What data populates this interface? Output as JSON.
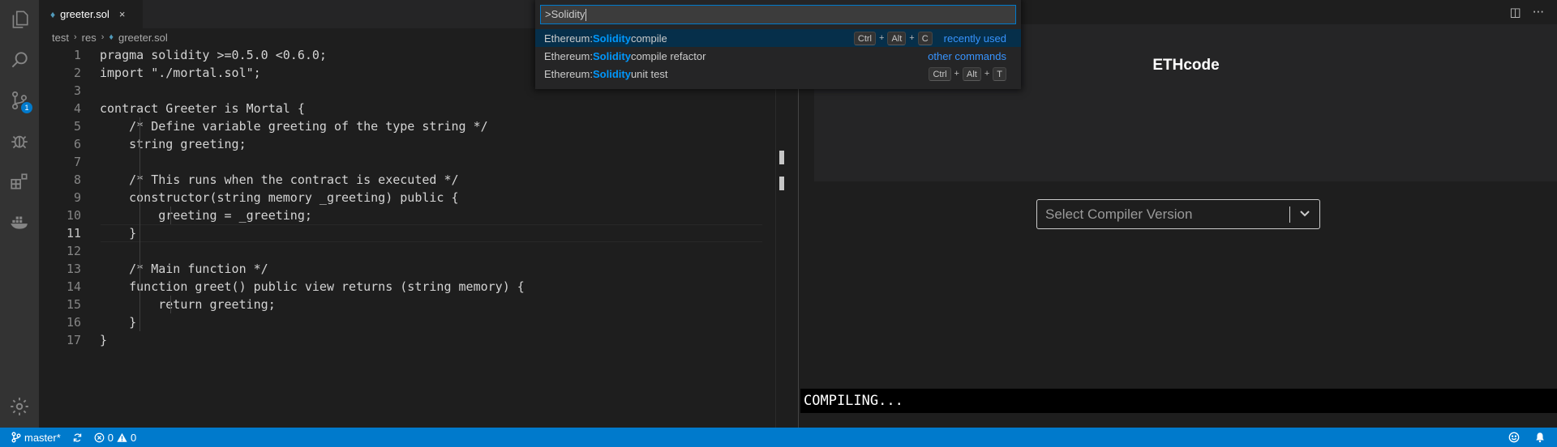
{
  "colors": {
    "accent": "#007acc",
    "highlight": "#0097fb",
    "link": "#3794ff",
    "selection": "#062f4a"
  },
  "activity_bar": {
    "items": [
      {
        "icon": "files-icon"
      },
      {
        "icon": "search-icon"
      },
      {
        "icon": "source-control-icon",
        "badge": "1"
      },
      {
        "icon": "debug-icon"
      },
      {
        "icon": "extensions-icon"
      },
      {
        "icon": "docker-icon"
      }
    ],
    "settings_icon": "gear-icon"
  },
  "editor": {
    "tab": {
      "label": "greeter.sol",
      "close": "×"
    },
    "breadcrumb": [
      "test",
      "res",
      "greeter.sol"
    ],
    "active_line": 11,
    "lines": [
      {
        "n": "1",
        "text": "pragma solidity >=0.5.0 <0.6.0;"
      },
      {
        "n": "2",
        "text": "import \"./mortal.sol\";"
      },
      {
        "n": "3",
        "text": ""
      },
      {
        "n": "4",
        "text": "contract Greeter is Mortal {"
      },
      {
        "n": "5",
        "text": "    /* Define variable greeting of the type string */"
      },
      {
        "n": "6",
        "text": "    string greeting;"
      },
      {
        "n": "7",
        "text": ""
      },
      {
        "n": "8",
        "text": "    /* This runs when the contract is executed */"
      },
      {
        "n": "9",
        "text": "    constructor(string memory _greeting) public {"
      },
      {
        "n": "10",
        "text": "        greeting = _greeting;"
      },
      {
        "n": "11",
        "text": "    }"
      },
      {
        "n": "12",
        "text": ""
      },
      {
        "n": "13",
        "text": "    /* Main function */"
      },
      {
        "n": "14",
        "text": "    function greet() public view returns (string memory) {"
      },
      {
        "n": "15",
        "text": "        return greeting;"
      },
      {
        "n": "16",
        "text": "    }"
      },
      {
        "n": "17",
        "text": "}"
      }
    ]
  },
  "command_palette": {
    "input_value": ">Solidity",
    "items": [
      {
        "prefix": "Ethereum: ",
        "match": "Solidity",
        "suffix": " compile",
        "keys": [
          "Ctrl",
          "Alt",
          "C"
        ],
        "tag": "recently used",
        "selected": true
      },
      {
        "prefix": "Ethereum: ",
        "match": "Solidity",
        "suffix": " compile refactor",
        "keys": [],
        "tag": "other commands",
        "selected": false
      },
      {
        "prefix": "Ethereum: ",
        "match": "Solidity",
        "suffix": " unit test",
        "keys": [
          "Ctrl",
          "Alt",
          "T"
        ],
        "tag": "",
        "selected": false
      }
    ]
  },
  "webview": {
    "title": "ETHcode",
    "select_placeholder": "Select Compiler Version",
    "output": "COMPILING...",
    "toolbar": {
      "split": "◫",
      "more": "···"
    }
  },
  "status_bar": {
    "branch": "master*",
    "errors": "0",
    "warnings": "0"
  }
}
